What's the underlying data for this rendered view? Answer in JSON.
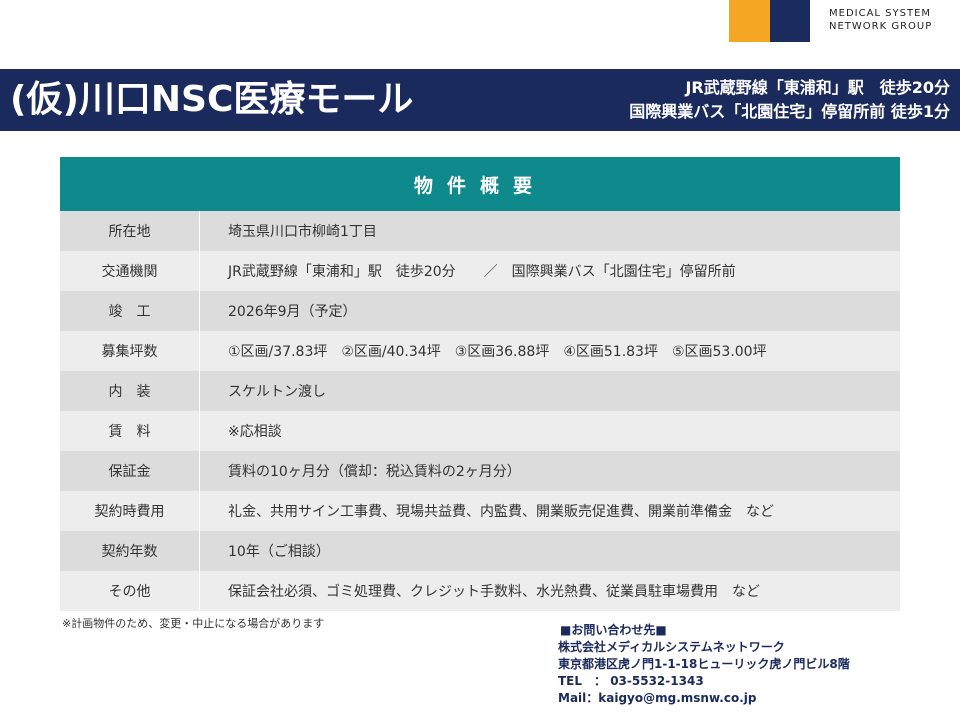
{
  "logo": {
    "line1": "MEDICAL SYSTEM",
    "line2": "NETWORK GROUP",
    "colors": {
      "orange": "#f5a623",
      "navy": "#1b2b5e"
    }
  },
  "header": {
    "title": "(仮)川口NSC医療モール",
    "access_line1": "JR武蔵野線「東浦和」駅　徒歩20分",
    "access_line2": "国際興業バス「北園住宅」停留所前 徒歩1分",
    "bar_color": "#1b2a5c"
  },
  "table": {
    "heading": "物件概要",
    "heading_color": "#0f8a8c",
    "rows": [
      {
        "label": "所在地",
        "value": "埼玉県川口市柳崎1丁目"
      },
      {
        "label": "交通機関",
        "value": "JR武蔵野線「東浦和」駅　徒歩20分　　／　国際興業バス「北園住宅」停留所前"
      },
      {
        "label": "竣　工",
        "value": "2026年9月（予定）"
      },
      {
        "label": "募集坪数",
        "value": "①区画/37.83坪　②区画/40.34坪　③区画36.88坪　④区画51.83坪　⑤区画53.00坪"
      },
      {
        "label": "内　装",
        "value": "スケルトン渡し"
      },
      {
        "label": "賃　料",
        "value": "※応相談"
      },
      {
        "label": "保証金",
        "value": "賃料の10ヶ月分（償却：税込賃料の2ヶ月分）"
      },
      {
        "label": "契約時費用",
        "value": "礼金、共用サイン工事費、現場共益費、内監費、開業販売促進費、開業前準備金　など"
      },
      {
        "label": "契約年数",
        "value": "10年（ご相談）"
      },
      {
        "label": "その他",
        "value": "保証会社必須、ゴミ処理費、クレジット手数料、水光熱費、従業員駐車場費用　など"
      }
    ]
  },
  "note": "※計画物件のため、変更・中止になる場合があります",
  "contact": {
    "heading": "■お問い合わせ先■",
    "company": "株式会社メディカルシステムネットワーク",
    "address": "東京都港区虎ノ門1-1-18ヒューリック虎ノ門ビル8階",
    "tel": "TEL　：  03-5532-1343",
    "mail": "Mail：kaigyo@mg.msnw.co.jp"
  }
}
